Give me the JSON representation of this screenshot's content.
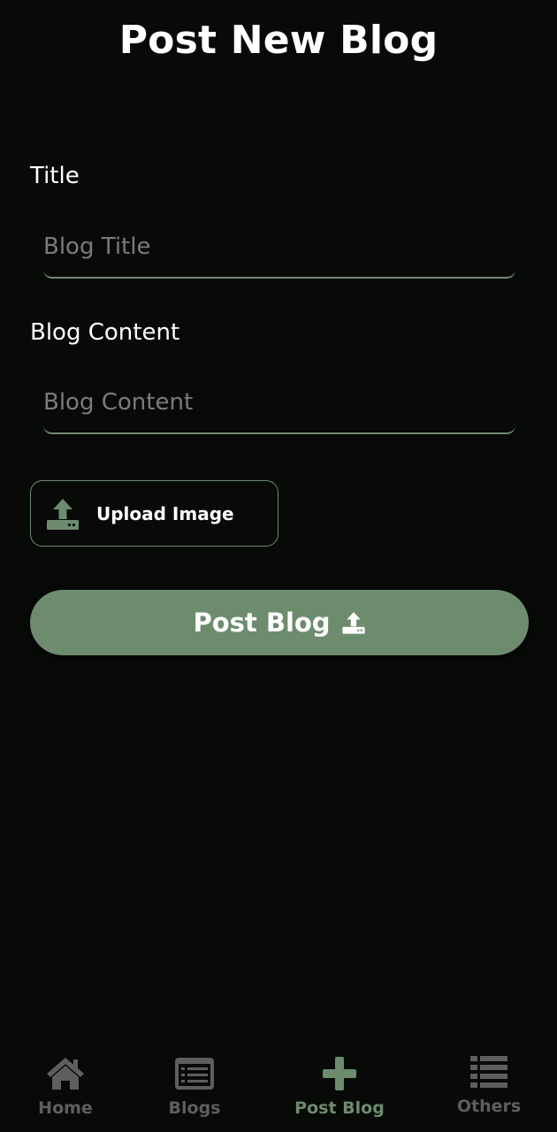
{
  "header": {
    "title": "Post New Blog"
  },
  "form": {
    "title_label": "Title",
    "title_placeholder": "Blog Title",
    "title_value": "",
    "content_label": "Blog Content",
    "content_placeholder": "Blog Content",
    "content_value": "",
    "upload_label": "Upload Image",
    "upload_icon": "upload-icon",
    "submit_label": "Post Blog",
    "submit_icon": "upload-icon"
  },
  "nav": {
    "items": [
      {
        "label": "Home",
        "icon": "home-icon",
        "active": false
      },
      {
        "label": "Blogs",
        "icon": "blog-list-icon",
        "active": false
      },
      {
        "label": "Post Blog",
        "icon": "plus-icon",
        "active": true
      },
      {
        "label": "Others",
        "icon": "list-icon",
        "active": false
      }
    ]
  },
  "colors": {
    "background": "#080a08",
    "accent": "#6d8c6e",
    "inactive": "#5e5e5e",
    "placeholder": "#7b7b7b"
  }
}
